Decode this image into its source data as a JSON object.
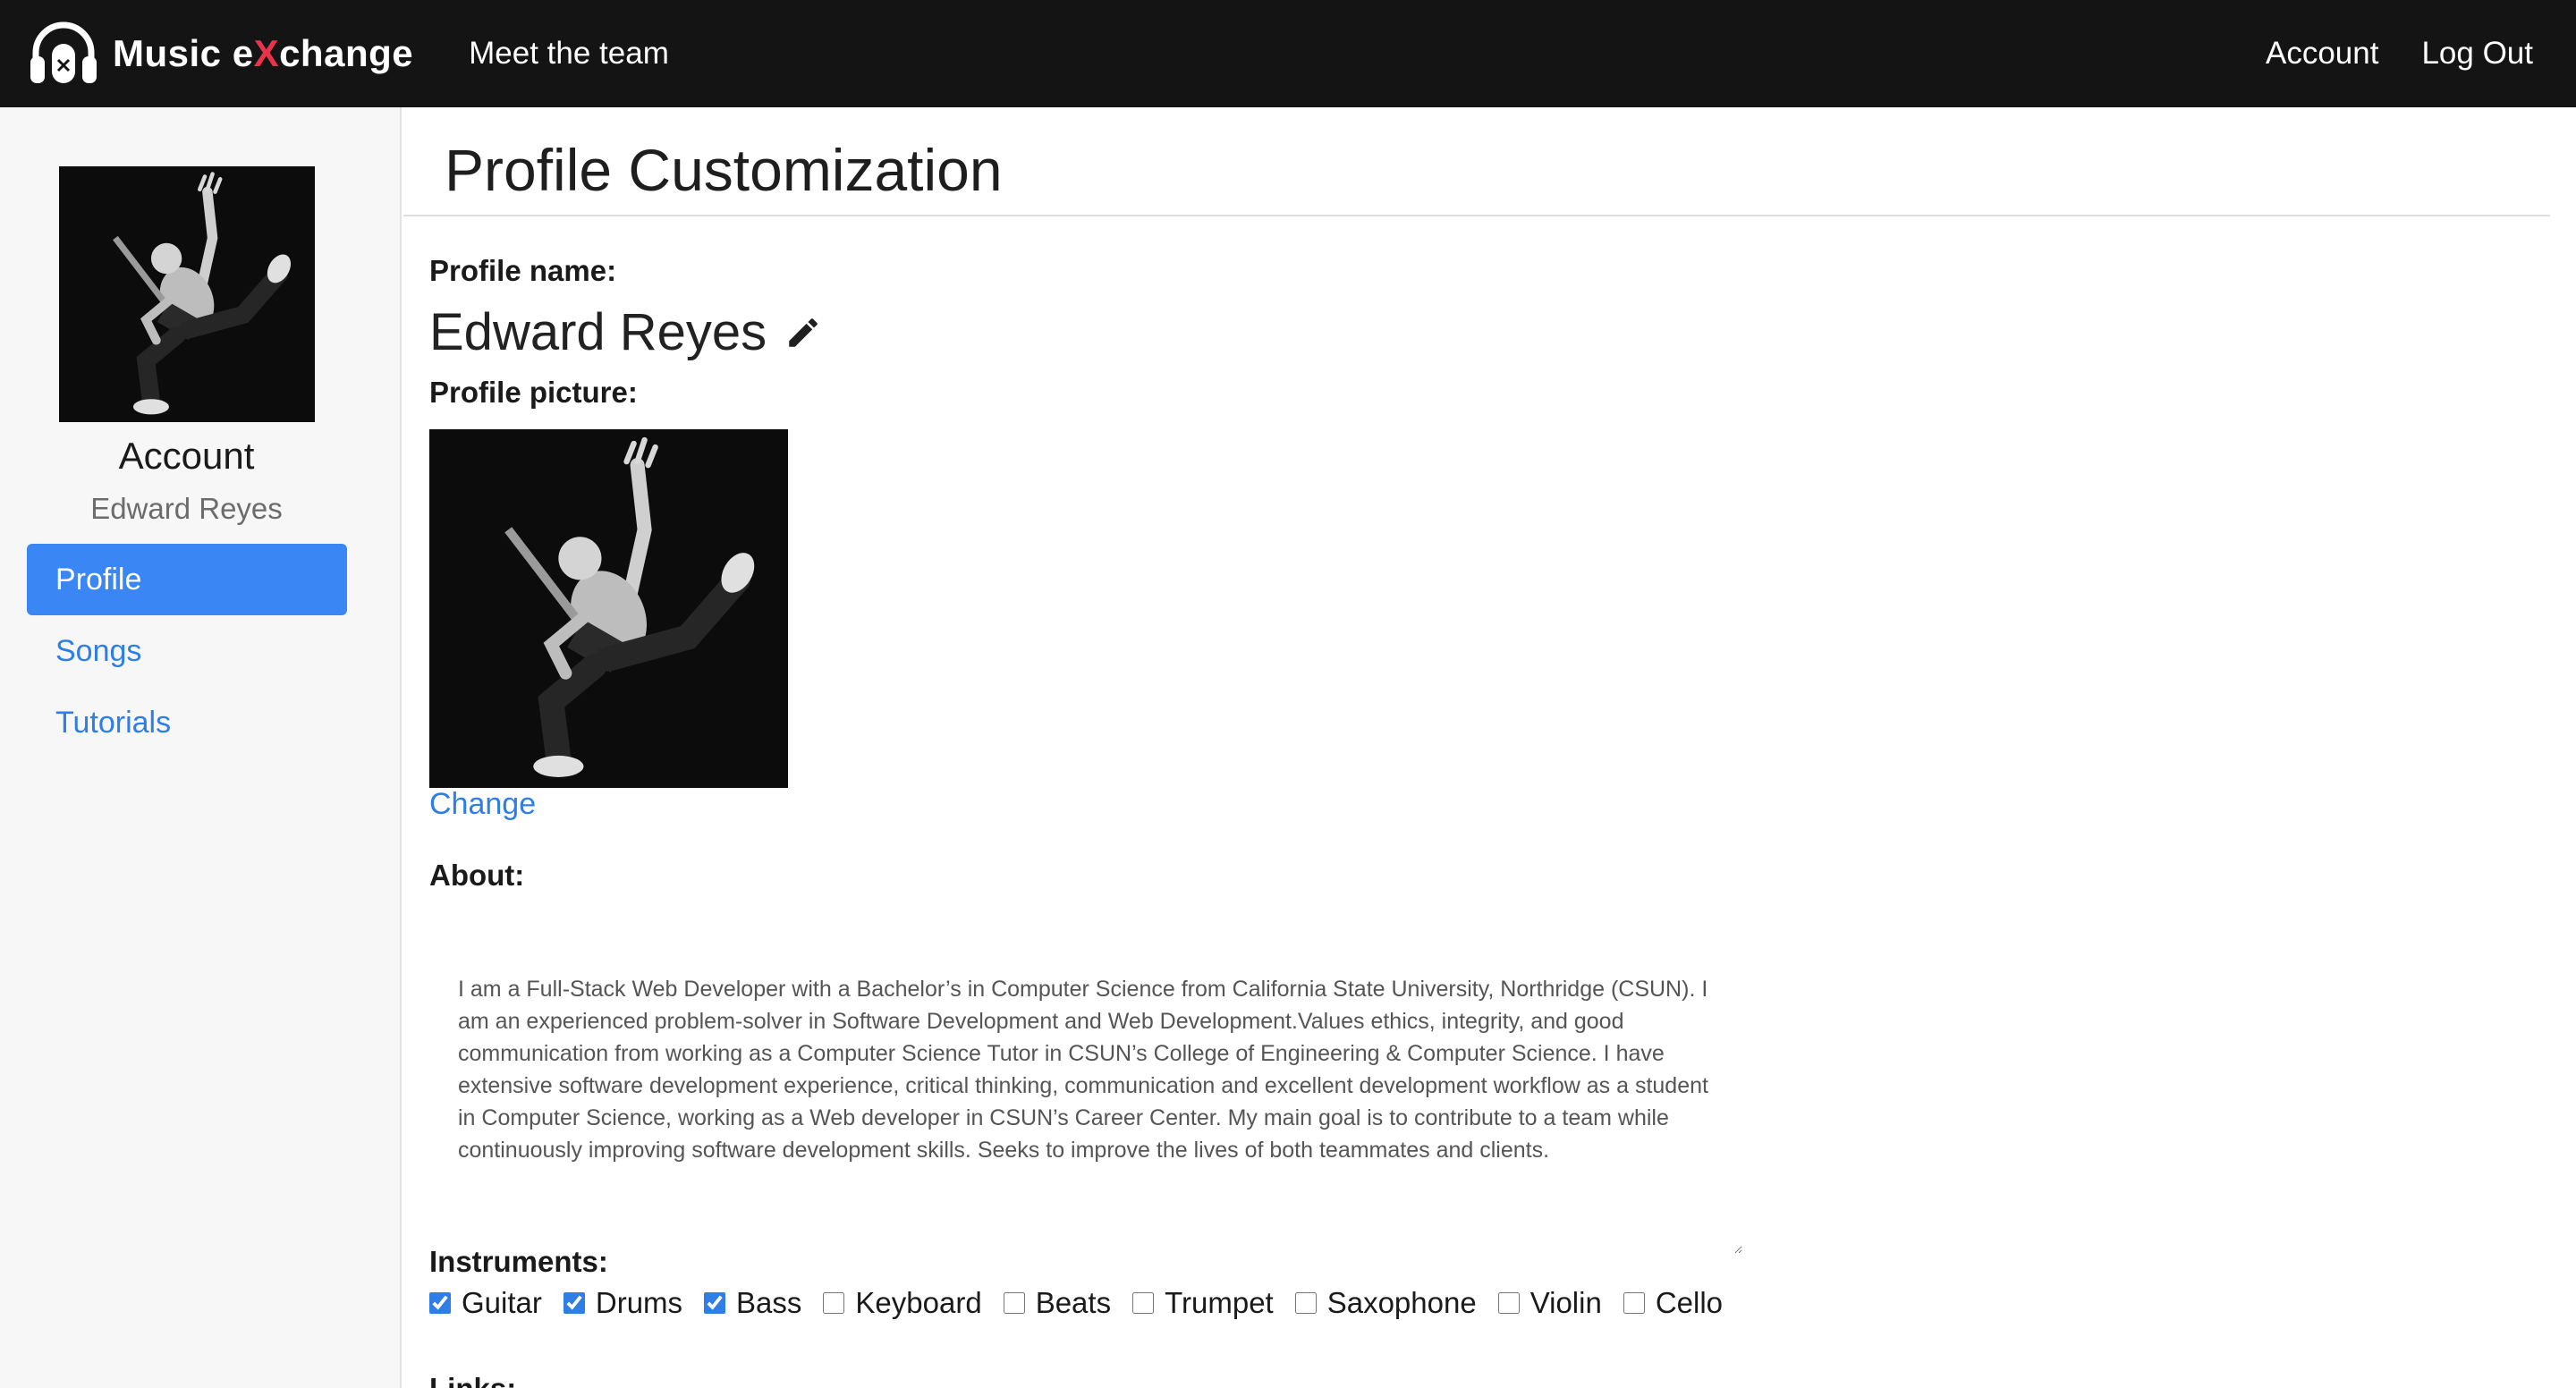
{
  "navbar": {
    "brand_prefix": "Music e",
    "brand_x": "X",
    "brand_suffix": "change",
    "brand_icon": "headphones-icon",
    "meet_team": "Meet the team",
    "account": "Account",
    "logout": "Log Out"
  },
  "sidebar": {
    "account_heading": "Account",
    "username": "Edward Reyes",
    "items": [
      {
        "label": "Profile",
        "active": true
      },
      {
        "label": "Songs",
        "active": false
      },
      {
        "label": "Tutorials",
        "active": false
      }
    ]
  },
  "main": {
    "title": "Profile Customization",
    "profile_name_label": "Profile name:",
    "profile_name": "Edward Reyes",
    "edit_icon": "pencil-icon",
    "profile_picture_label": "Profile picture:",
    "change_label": "Change",
    "about_label": "About:",
    "about_text": "I am a Full-Stack Web Developer with a Bachelor’s in Computer Science from California State University, Northridge (CSUN). I am an experienced problem-solver in Software Development and Web Development.Values ethics, integrity, and good communication from working as a Computer Science Tutor in CSUN’s College of Engineering & Computer Science. I have extensive software development experience, critical thinking, communication and excellent development workflow as a student in Computer Science, working as a Web developer in CSUN’s Career Center. My main goal is to contribute to a team while continuously improving software development skills. Seeks to improve the lives of both teammates and clients.",
    "instruments_label": "Instruments:",
    "instruments": [
      {
        "label": "Guitar",
        "checked": true
      },
      {
        "label": "Drums",
        "checked": true
      },
      {
        "label": "Bass",
        "checked": true
      },
      {
        "label": "Keyboard",
        "checked": false
      },
      {
        "label": "Beats",
        "checked": false
      },
      {
        "label": "Trumpet",
        "checked": false
      },
      {
        "label": "Saxophone",
        "checked": false
      },
      {
        "label": "Violin",
        "checked": false
      },
      {
        "label": "Cello",
        "checked": false
      }
    ],
    "links_label": "Links:"
  },
  "colors": {
    "navbar_bg": "#141414",
    "accent": "#3a86f4",
    "link": "#2f7ee5",
    "brand_x": "#e8344a"
  }
}
